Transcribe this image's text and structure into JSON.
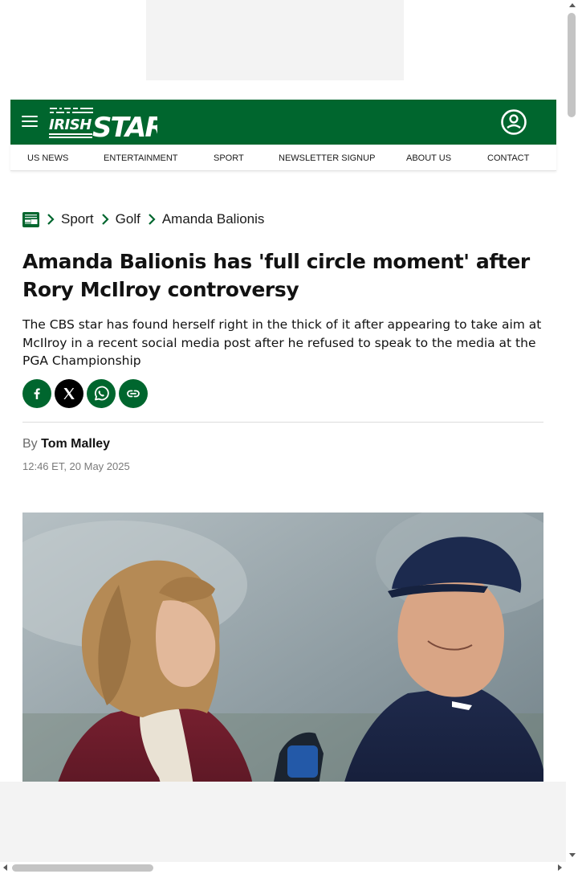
{
  "brand": {
    "name_part1": "IRISH",
    "name_part2": "STAR",
    "color": "#00662e"
  },
  "header": {
    "menu_icon": "hamburger-menu-icon",
    "account_icon": "user-account-icon"
  },
  "nav": {
    "items": [
      {
        "label": "US NEWS"
      },
      {
        "label": "ENTERTAINMENT"
      },
      {
        "label": "SPORT"
      },
      {
        "label": "NEWSLETTER SIGNUP"
      },
      {
        "label": "ABOUT US"
      },
      {
        "label": "CONTACT"
      }
    ]
  },
  "breadcrumb": {
    "home_icon": "irish-star-home-icon",
    "items": [
      {
        "label": "Sport"
      },
      {
        "label": "Golf"
      },
      {
        "label": "Amanda Balionis"
      }
    ]
  },
  "article": {
    "headline": "Amanda Balionis has 'full circle moment' after Rory McIlroy controversy",
    "standfirst": "The CBS star has found herself right in the thick of it after appearing to take aim at McIlroy in a recent social media post after he refused to speak to the media at the PGA Championship",
    "share": [
      {
        "icon": "facebook-icon"
      },
      {
        "icon": "x-twitter-icon"
      },
      {
        "icon": "whatsapp-icon"
      },
      {
        "icon": "copy-link-icon"
      }
    ],
    "byline_prefix": "By",
    "author": "Tom Malley",
    "date": "12:46 ET, 20 May 2025"
  }
}
